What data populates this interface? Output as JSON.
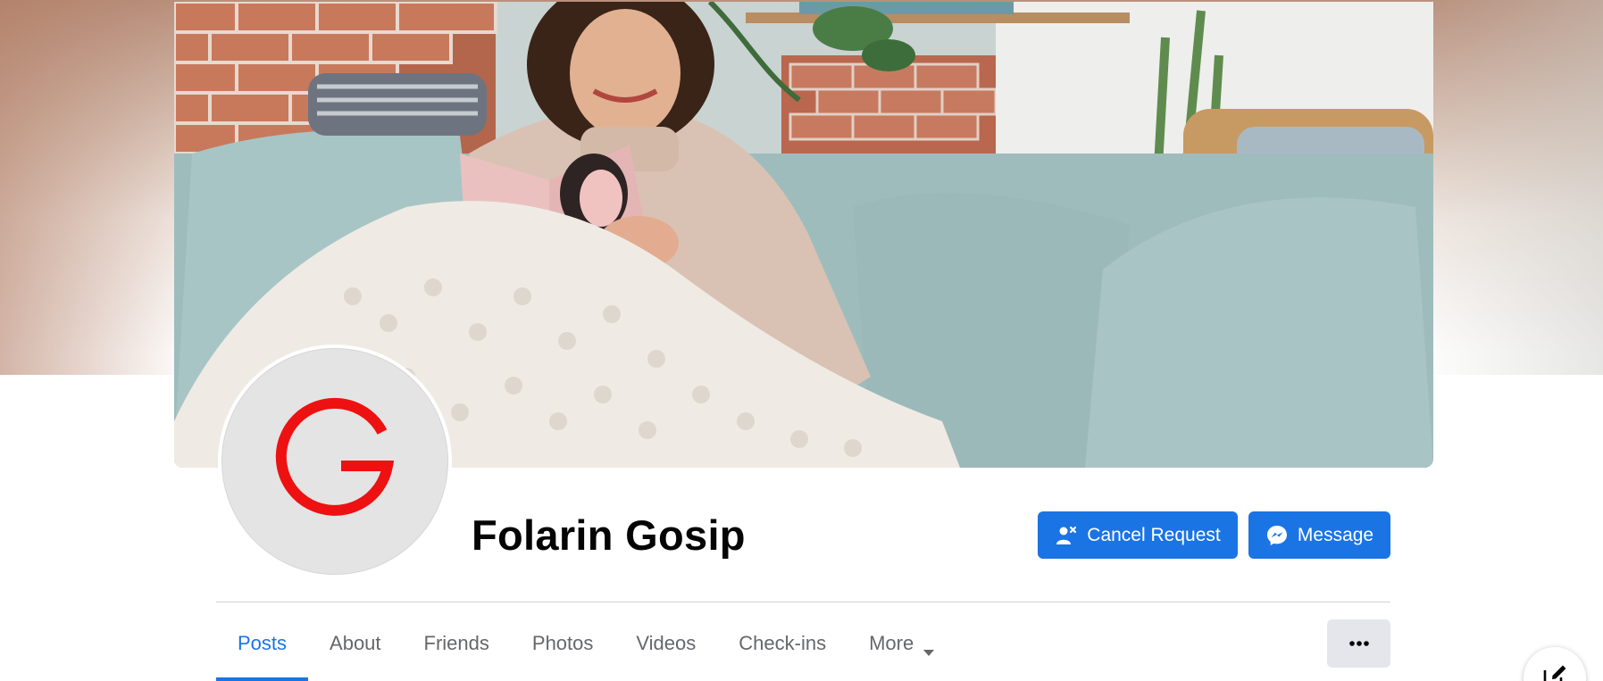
{
  "profile": {
    "name": "Folarin Gosip",
    "avatar_letter": "G",
    "avatar_letter_color": "#ee1111"
  },
  "actions": {
    "cancel_request_label": "Cancel Request",
    "message_label": "Message"
  },
  "tabs": [
    {
      "label": "Posts",
      "active": true
    },
    {
      "label": "About"
    },
    {
      "label": "Friends"
    },
    {
      "label": "Photos"
    },
    {
      "label": "Videos"
    },
    {
      "label": "Check-ins"
    },
    {
      "label": "More"
    }
  ],
  "icons": {
    "cancel_request": "user-remove-icon",
    "message": "messenger-icon",
    "more_tab": "caret-down-icon",
    "overflow": "ellipsis-icon",
    "compose": "compose-icon"
  },
  "colors": {
    "accent": "#1b74e4",
    "tab_inactive": "#65676b",
    "name_text": "#050505",
    "overflow_button_bg": "#e4e6eb"
  }
}
